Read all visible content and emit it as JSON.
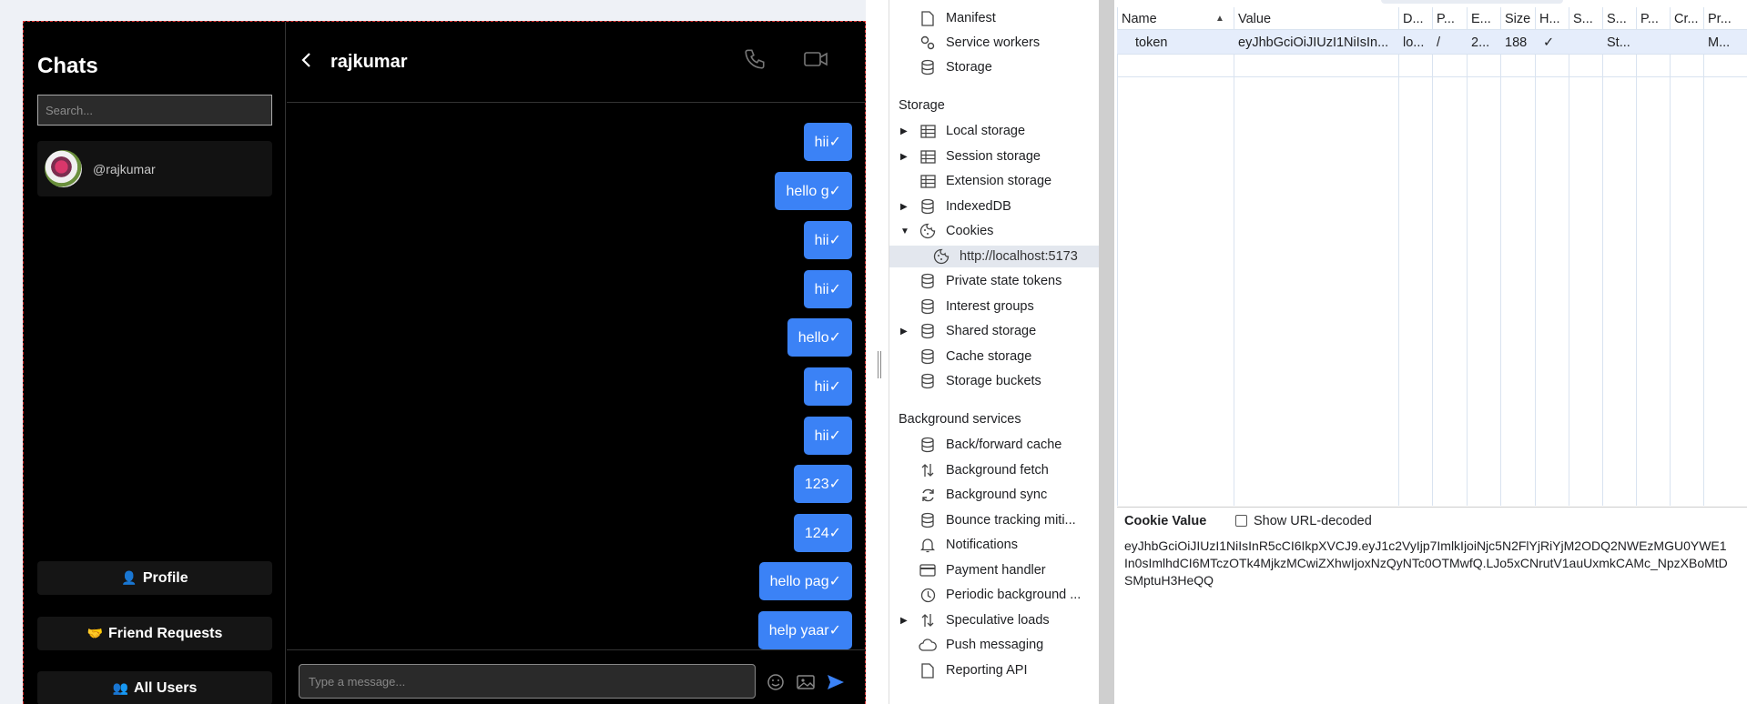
{
  "chat_app": {
    "sidebar": {
      "title": "Chats",
      "search_placeholder": "Search...",
      "contact": {
        "handle": "@rajkumar"
      },
      "buttons": [
        {
          "icon": "👤",
          "label": "Profile"
        },
        {
          "icon": "🤝",
          "label": "Friend Requests"
        },
        {
          "icon": "👥",
          "label": "All Users"
        }
      ]
    },
    "header": {
      "name": "rajkumar"
    },
    "messages": [
      "hii✓",
      "hello g✓",
      "hii✓",
      "hii✓",
      "hello✓",
      "hii✓",
      "hii✓",
      "123✓",
      "124✓",
      "hello pag✓",
      "help yaar✓"
    ],
    "composer": {
      "placeholder": "Type a message..."
    },
    "colors": {
      "bubble": "#3b82f6",
      "background": "#000000"
    }
  },
  "devtools": {
    "tree": {
      "top_items": [
        "Manifest",
        "Service workers",
        "Storage"
      ],
      "storage_heading": "Storage",
      "storage_items": [
        "Local storage",
        "Session storage",
        "Extension storage",
        "IndexedDB",
        "Cookies",
        "http://localhost:5173",
        "Private state tokens",
        "Interest groups",
        "Shared storage",
        "Cache storage",
        "Storage buckets"
      ],
      "background_heading": "Background services",
      "background_items": [
        "Back/forward cache",
        "Background fetch",
        "Background sync",
        "Bounce tracking miti...",
        "Notifications",
        "Payment handler",
        "Periodic background ...",
        "Speculative loads",
        "Push messaging",
        "Reporting API"
      ]
    },
    "cookie_table": {
      "headers": [
        "Name",
        "Value",
        "D...",
        "P...",
        "E...",
        "Size",
        "H...",
        "S...",
        "S...",
        "P...",
        "Cr...",
        "Pr..."
      ],
      "sort_indicator": "▲",
      "rows": [
        [
          "token",
          "eyJhbGciOiJIUzI1NiIsIn...",
          "lo...",
          "/",
          "2...",
          "188",
          "✓",
          "",
          "St...",
          "",
          "",
          "M..."
        ]
      ]
    },
    "cookie_value": {
      "title": "Cookie Value",
      "checkbox_label": "Show URL-decoded",
      "checkbox_checked": false,
      "value": "eyJhbGciOiJIUzI1NiIsInR5cCI6IkpXVCJ9.eyJ1c2VyIjp7ImlkIjoiNjc5N2FlYjRiYjM2ODQ2NWEzMGU0YWE1In0sImlhdCI6MTczOTk4MjkzMCwiZXhwIjoxNzQyNTc0OTMwfQ.LJo5xCNrutV1auUxmkCAMc_NpzXBoMtDSMptuH3HeQQ"
    }
  }
}
